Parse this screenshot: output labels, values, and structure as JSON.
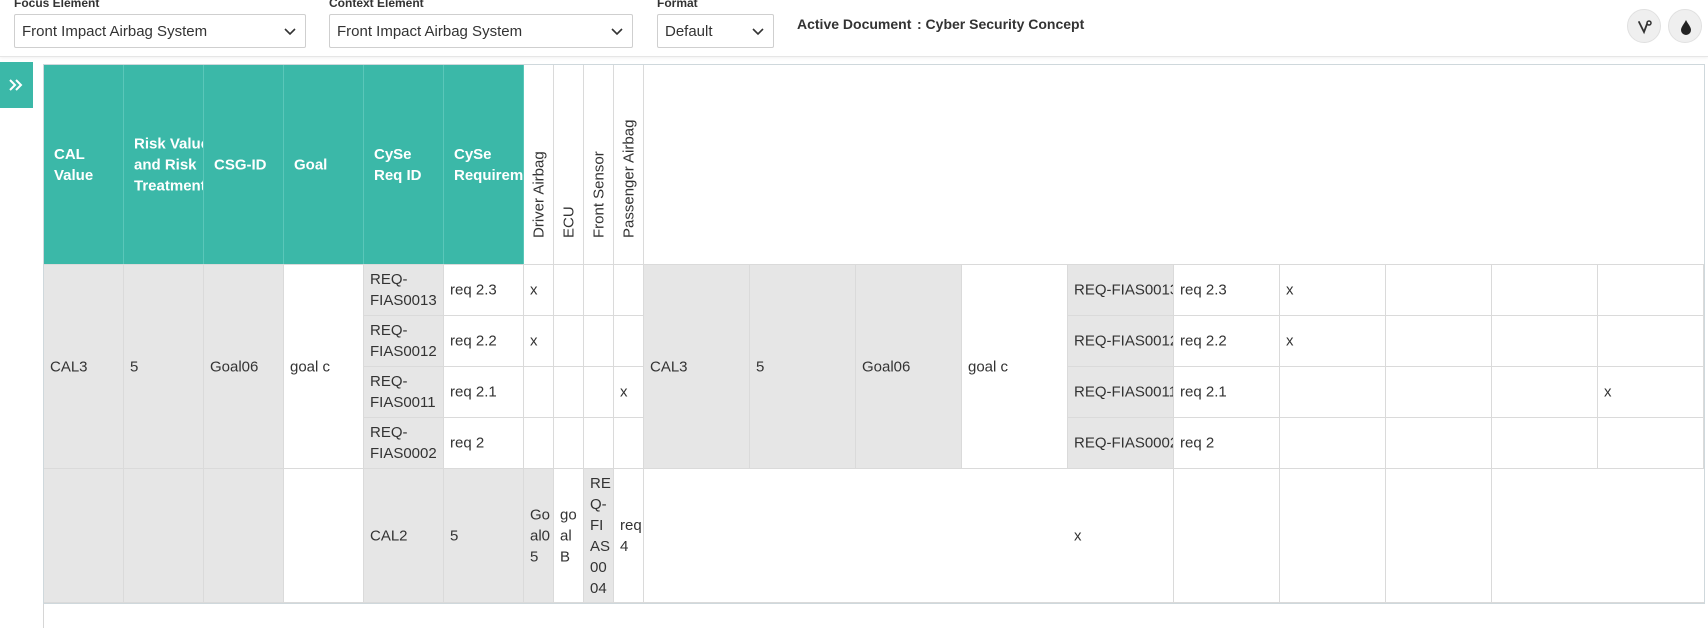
{
  "toolbar": {
    "focus_label": "Focus Element",
    "focus_value": "Front Impact Airbag System",
    "context_label": "Context Element",
    "context_value": "Front Impact Airbag System",
    "format_label": "Format",
    "format_value": "Default",
    "active_doc_label": "Active Document",
    "active_doc_value": ": Cyber Security Concept",
    "icons": [
      "version-icon",
      "drop-icon"
    ]
  },
  "grid": {
    "headers": [
      "CAL\nValue",
      "Risk Value\nand Risk\nTreatment",
      "CSG-ID",
      "Goal",
      "CySe\nReq ID",
      "CySe\nRequirement"
    ],
    "component_headers": [
      "Driver Airbag",
      "ECU",
      "Front Sensor",
      "Passenger Airbag"
    ],
    "block1": {
      "cal": "CAL3",
      "risk": "5",
      "csg": "Goal06",
      "goal": "goal c",
      "rows": [
        {
          "req_id": "REQ-FIAS0013",
          "req": "req 2.3",
          "marks": [
            "x",
            "",
            "",
            ""
          ]
        },
        {
          "req_id": "REQ-FIAS0012",
          "req": "req 2.2",
          "marks": [
            "x",
            "",
            "",
            ""
          ]
        },
        {
          "req_id": "REQ-FIAS0011",
          "req": "req 2.1",
          "marks": [
            "",
            "",
            "",
            "x"
          ]
        },
        {
          "req_id": "REQ-FIAS0002",
          "req": "req 2",
          "marks": [
            "",
            "",
            "",
            ""
          ]
        }
      ]
    },
    "block2": {
      "cal": "CAL2",
      "risk": "5",
      "csg": "Goal05",
      "goal": "goal B",
      "req_id": "REQ-FIAS0004",
      "req": "req 4",
      "mark": "x"
    }
  },
  "colors": {
    "accent": "#3bb8a8",
    "grey_cell": "#e6e6e6"
  }
}
